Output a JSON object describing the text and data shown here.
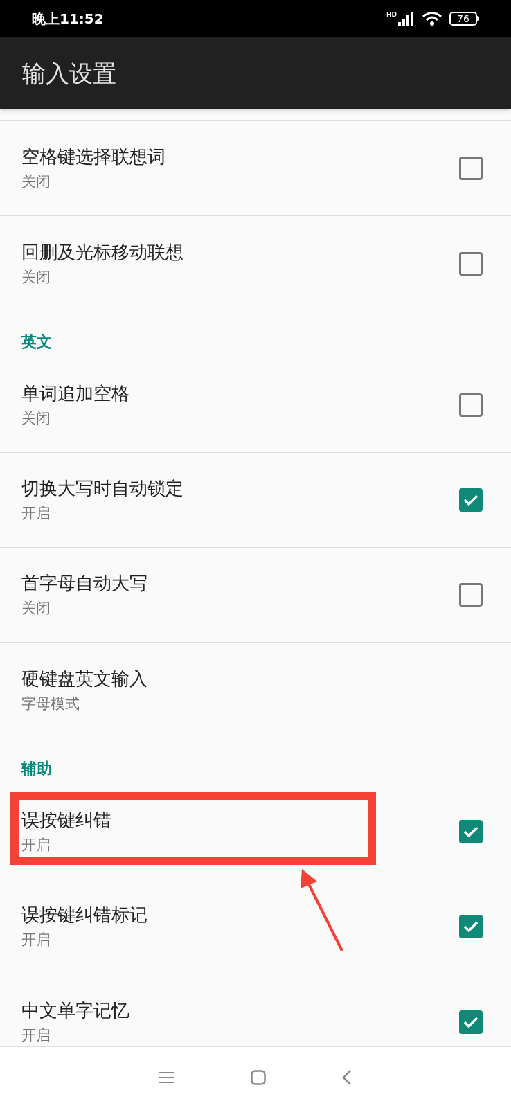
{
  "status_bar": {
    "time": "晚上11:52",
    "network_label": "HD",
    "battery": "76"
  },
  "app_bar": {
    "title": "输入设置"
  },
  "items": [
    {
      "kind": "checkbox",
      "title": "空格键选择联想词",
      "summary": "关闭",
      "checked": false
    },
    {
      "kind": "checkbox",
      "title": "回删及光标移动联想",
      "summary": "关闭",
      "checked": false
    },
    {
      "kind": "header",
      "title": "英文"
    },
    {
      "kind": "checkbox",
      "title": "单词追加空格",
      "summary": "关闭",
      "checked": false
    },
    {
      "kind": "checkbox",
      "title": "切换大写时自动锁定",
      "summary": "开启",
      "checked": true
    },
    {
      "kind": "checkbox",
      "title": "首字母自动大写",
      "summary": "关闭",
      "checked": false
    },
    {
      "kind": "plain",
      "title": "硬键盘英文输入",
      "summary": "字母模式"
    },
    {
      "kind": "header",
      "title": "辅助"
    },
    {
      "kind": "checkbox",
      "title": "误按键纠错",
      "summary": "开启",
      "checked": true,
      "annotated": true
    },
    {
      "kind": "checkbox",
      "title": "误按键纠错标记",
      "summary": "开启",
      "checked": true
    },
    {
      "kind": "checkbox",
      "title": "中文单字记忆",
      "summary": "开启",
      "checked": true
    }
  ]
}
